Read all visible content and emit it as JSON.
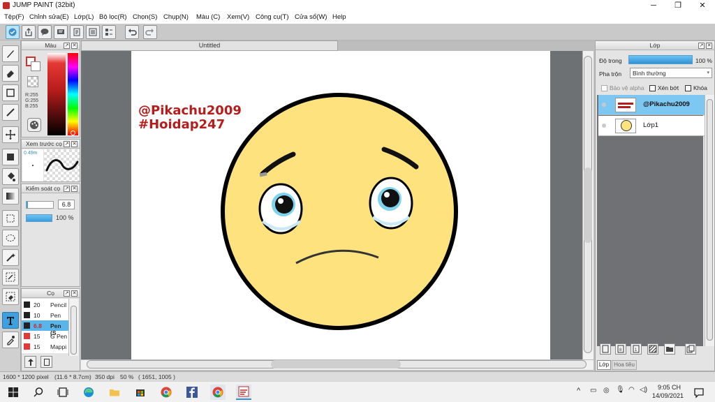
{
  "window": {
    "title": "JUMP PAINT (32bit)",
    "minimize": "─",
    "maximize": "❐",
    "close": "✕"
  },
  "menu": [
    "Tệp(F)",
    "Chỉnh sửa(E)",
    "Lớp(L)",
    "Bộ lọc(R)",
    "Chọn(S)",
    "Chụp(N)",
    "Màu (C)",
    "Xem(V)",
    "Công cụ(T)",
    "Cửa sổ(W)",
    "Help"
  ],
  "document": {
    "tab_title": "Untitled"
  },
  "canvas": {
    "text_line1": "@Pikachu2009",
    "text_line2": "#Hoidap247",
    "text_color": "#b71c1c",
    "face_color": "#fde27e"
  },
  "color_panel": {
    "title": "Màu",
    "r": "R:255",
    "g": "G:255",
    "b": "B:255"
  },
  "brush_preview": {
    "title": "Xem trước cọ",
    "size": "0.49m"
  },
  "brush_control": {
    "title": "Kiểm soát cọ",
    "size_value": "6.8",
    "opacity_value": "100 %"
  },
  "brush_list": {
    "title": "Cọ",
    "items": [
      {
        "size": "20",
        "name": "Pencil",
        "color": "#222222",
        "selected": false
      },
      {
        "size": "10",
        "name": "Pen",
        "color": "#222222",
        "selected": false
      },
      {
        "size": "6.8",
        "name": "Pen (S",
        "color": "#222222",
        "selected": true
      },
      {
        "size": "15",
        "name": "G Pen",
        "color": "#e53935",
        "selected": false
      },
      {
        "size": "15",
        "name": "Mappi",
        "color": "#e53935",
        "selected": false
      }
    ]
  },
  "layer_panel": {
    "title": "Lớp",
    "opacity_label": "Độ trong",
    "opacity_value": "100 %",
    "blend_label": "Pha trộn",
    "blend_value": "Bình thường",
    "protect_alpha": "Bảo vệ alpha",
    "clip": "Xén bớt",
    "lock": "Khóa",
    "layers": [
      {
        "name": "@Pikachu2009",
        "selected": true
      },
      {
        "name": "Lớp1",
        "selected": false
      }
    ],
    "tab_layers": "Lớp",
    "tab_pattern": "Hoa tiêu"
  },
  "status": {
    "size": "1600 * 1200 pixel",
    "cm": "(11.6 * 8.7cm)",
    "dpi": "350 dpi",
    "zoom": "50 %",
    "coords": "( 1651, 1005 )"
  },
  "taskbar": {
    "time": "9:05 CH",
    "date": "14/09/2021"
  }
}
